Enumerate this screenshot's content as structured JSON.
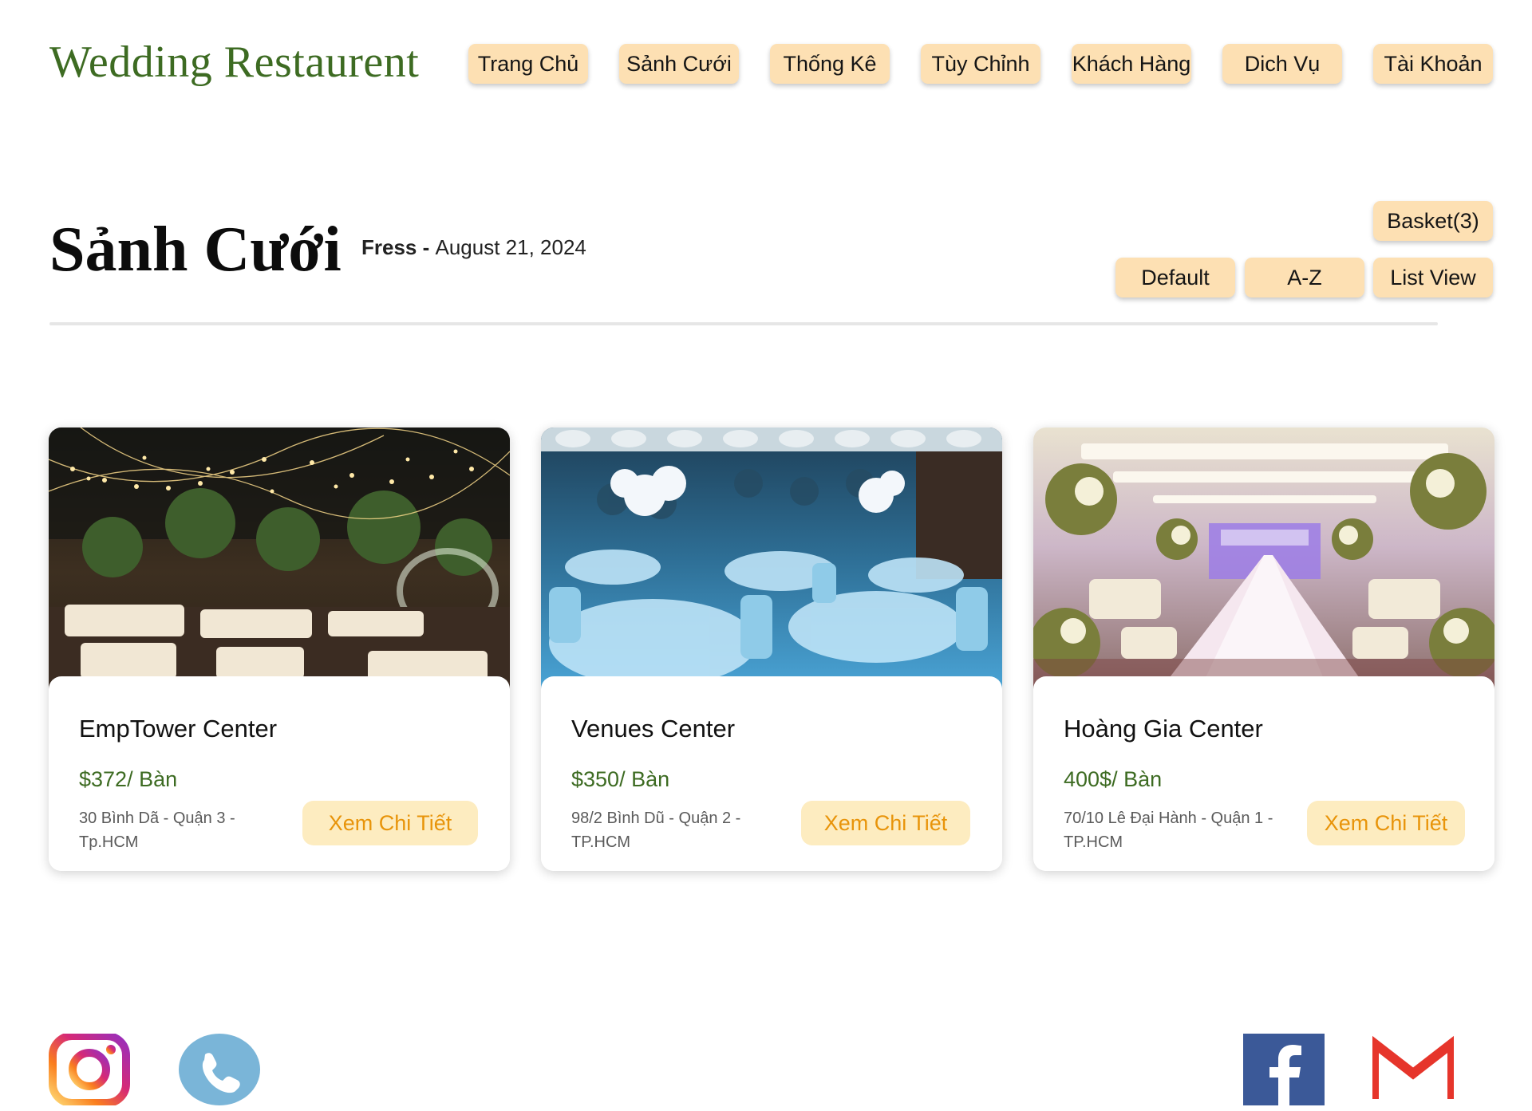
{
  "brand": "Wedding Restaurent",
  "nav": [
    "Trang Chủ",
    "Sảnh Cưới",
    "Thống Kê",
    "Tùy Chỉnh",
    "Khách Hàng",
    "Dich Vụ",
    "Tài Khoản"
  ],
  "header": {
    "title": "Sảnh Cưới",
    "author": "Fress",
    "separator": " - ",
    "date": "August 21, 2024"
  },
  "toolbar": {
    "basket": "Basket(3)",
    "sort_default": "Default",
    "sort_az": "A-Z",
    "view": "List View"
  },
  "cards": [
    {
      "name": "EmpTower Center",
      "price": "$372/ Bàn",
      "address": "30 Bình Dã - Quận 3 - Tp.HCM",
      "button": "Xem Chi Tiết"
    },
    {
      "name": "Venues Center",
      "price": "$350/ Bàn",
      "address": "98/2 Bình Dũ - Quận 2 - TP.HCM",
      "button": "Xem Chi Tiết"
    },
    {
      "name": "Hoàng Gia Center",
      "price": "400$/ Bàn",
      "address": "70/10 Lê Đại Hành - Quận 1 - TP.HCM",
      "button": "Xem Chi Tiết"
    }
  ],
  "social": [
    "instagram-icon",
    "phone-icon",
    "facebook-icon",
    "gmail-icon"
  ],
  "colors": {
    "accent": "#fde0b3",
    "brand": "#3d6b22",
    "button_text": "#e8940a",
    "button_bg": "#fdecc0"
  }
}
